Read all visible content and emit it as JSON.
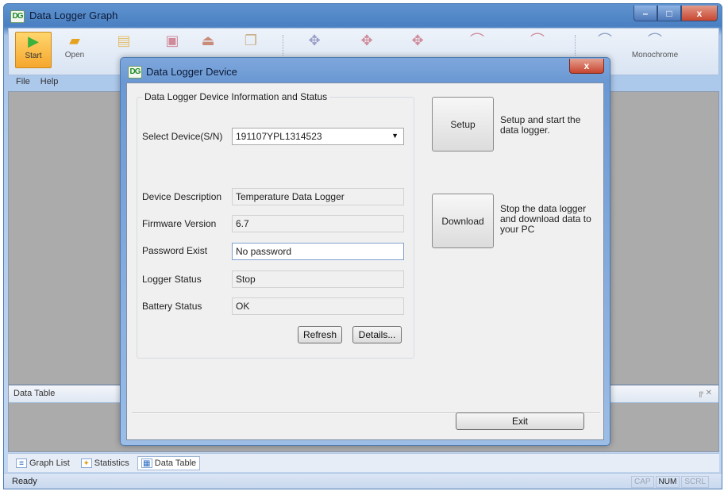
{
  "main_window": {
    "icon_text": "DG",
    "title": "Data Logger Graph",
    "minimize": "–",
    "maximize": "□",
    "close": "x"
  },
  "ribbon": {
    "start": {
      "label": "Start",
      "icon": "play-icon",
      "glyph": "▶"
    },
    "open": {
      "label": "Open",
      "icon": "folder-icon",
      "glyph": "▰"
    },
    "tools": [
      {
        "name": "chart-tool-icon",
        "glyph": "▤"
      },
      {
        "name": "save-icon",
        "glyph": "▣"
      },
      {
        "name": "upload-icon",
        "glyph": "⏏"
      },
      {
        "name": "copy-icon",
        "glyph": "❐"
      },
      {
        "name": "move-icon",
        "glyph": "✥"
      },
      {
        "name": "move-icon",
        "glyph": "✥"
      },
      {
        "name": "move-icon",
        "glyph": "✥"
      },
      {
        "name": "curve-icon",
        "glyph": "⌒"
      },
      {
        "name": "curve-icon",
        "glyph": "⌒"
      },
      {
        "name": "graph-icon",
        "glyph": "⌒"
      }
    ],
    "monochrome": {
      "label": "Monochrome",
      "icon": "graph-icon",
      "glyph": "⌒"
    }
  },
  "menu": {
    "file": "File",
    "help": "Help"
  },
  "panels": {
    "data_table_title": "Data Table",
    "pin": "╔ ✕"
  },
  "bottom_tabs": [
    {
      "label": "Graph List",
      "glyph": "≡"
    },
    {
      "label": "Statistics",
      "glyph": "✦"
    },
    {
      "label": "Data Table",
      "glyph": "▦"
    }
  ],
  "status_bar": {
    "text": "Ready",
    "cap": "CAP",
    "num": "NUM",
    "scrl": "SCRL"
  },
  "dialog": {
    "icon_text": "DG",
    "title": "Data Logger Device",
    "close": "x",
    "group_title": "Data Logger Device Information and Status",
    "select_device_label": "Select Device(S/N)",
    "select_device_value": "191107YPL1314523",
    "fields": {
      "description_label": "Device Description",
      "description_value": "Temperature Data Logger",
      "firmware_label": "Firmware Version",
      "firmware_value": "6.7",
      "password_label": "Password Exist",
      "password_value": "No password",
      "logger_status_label": "Logger Status",
      "logger_status_value": "Stop",
      "battery_label": "Battery Status",
      "battery_value": "OK"
    },
    "refresh_label": "Refresh",
    "details_label": "Details...",
    "setup_label": "Setup",
    "setup_desc": "Setup and start the data logger.",
    "download_label": "Download",
    "download_desc": "Stop the data logger and download data to your PC",
    "exit_label": "Exit"
  }
}
